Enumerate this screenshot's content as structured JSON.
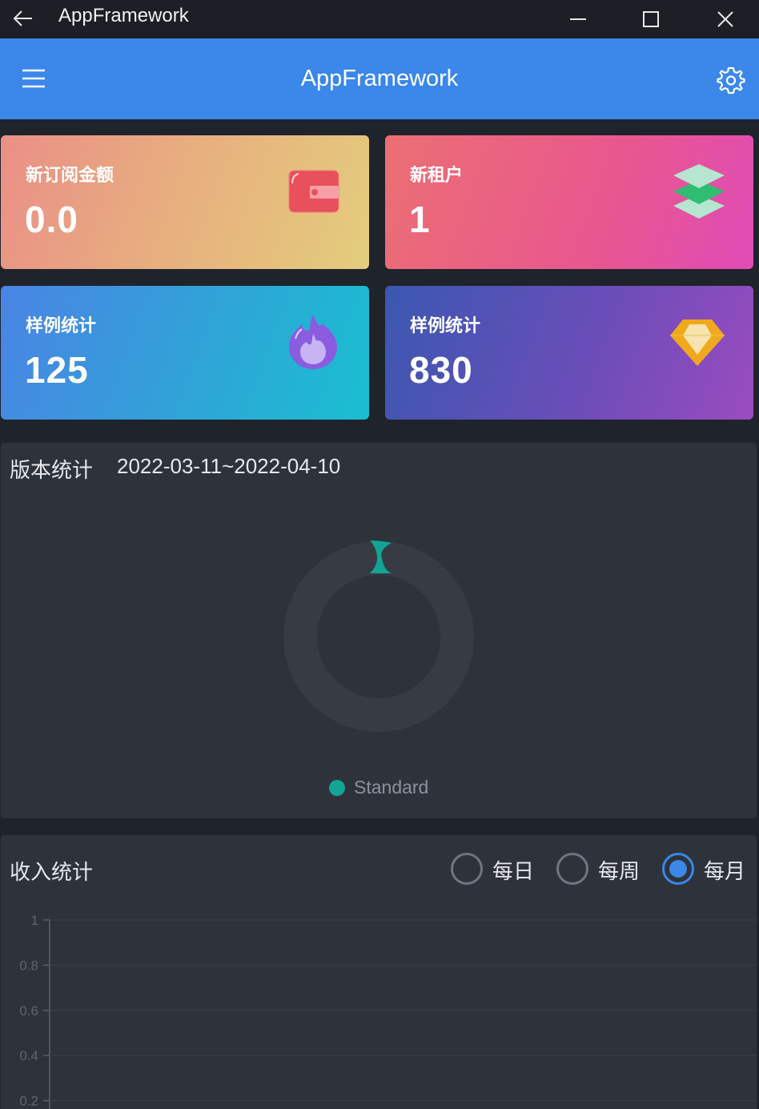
{
  "window": {
    "title": "AppFramework"
  },
  "appbar": {
    "title": "AppFramework"
  },
  "cards": [
    {
      "label": "新订阅金额",
      "value": "0.0",
      "icon": "wallet-icon"
    },
    {
      "label": "新租户",
      "value": "1",
      "icon": "layers-icon"
    },
    {
      "label": "样例统计",
      "value": "125",
      "icon": "flame-icon"
    },
    {
      "label": "样例统计",
      "value": "830",
      "icon": "diamond-icon"
    }
  ],
  "edition_panel": {
    "title": "版本统计",
    "date_range": "2022-03-11~2022-04-10",
    "legend": [
      {
        "name": "Standard",
        "color": "#13a594"
      }
    ]
  },
  "income_panel": {
    "title": "收入统计",
    "options": [
      {
        "label": "每日",
        "selected": false
      },
      {
        "label": "每周",
        "selected": false
      },
      {
        "label": "每月",
        "selected": true
      }
    ]
  },
  "chart_data": {
    "type": "line",
    "y_ticks": [
      "1",
      "0.8",
      "0.6",
      "0.4",
      "0.2"
    ],
    "ylim": [
      0,
      1
    ],
    "series": [],
    "grid": true
  }
}
